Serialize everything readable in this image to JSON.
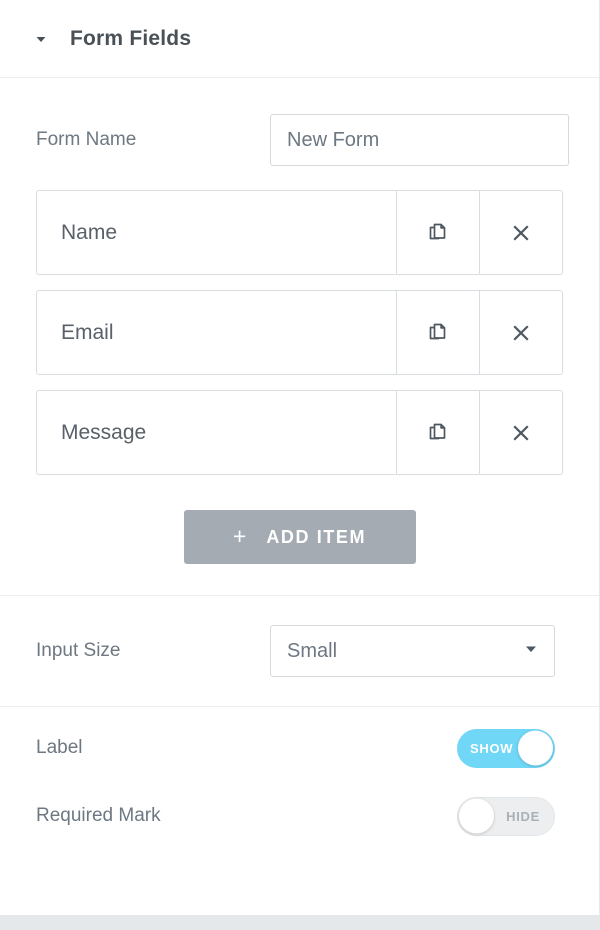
{
  "panel": {
    "header": {
      "title": "Form Fields",
      "caret_icon": "caret-down-icon"
    },
    "form_name": {
      "label": "Form Name",
      "value": "New Form",
      "placeholder": "Form Name"
    },
    "repeater": {
      "items": [
        {
          "title": "Name",
          "duplicate_icon": "duplicate-icon",
          "remove_icon": "close-icon"
        },
        {
          "title": "Email",
          "duplicate_icon": "duplicate-icon",
          "remove_icon": "close-icon"
        },
        {
          "title": "Message",
          "duplicate_icon": "duplicate-icon",
          "remove_icon": "close-icon"
        }
      ],
      "add_button": {
        "plus": "+",
        "label": "Add Item"
      }
    },
    "input_size": {
      "label": "Input Size",
      "value": "Small",
      "options": [
        "Small"
      ],
      "caret_icon": "chevron-down-icon"
    },
    "toggles": [
      {
        "label": "Label",
        "state": "on",
        "state_text": "SHOW"
      },
      {
        "label": "Required Mark",
        "state": "off",
        "state_text": "HIDE"
      }
    ]
  },
  "colors": {
    "toggle_on": "#71d7f7",
    "toggle_off": "#eceef0",
    "add_item_bg": "#a4abb2",
    "title_text": "#495157",
    "label_text": "#6d7882",
    "border": "#d5dadf",
    "divider": "#eceef2",
    "bottom_strip": "#e4e8eb"
  }
}
